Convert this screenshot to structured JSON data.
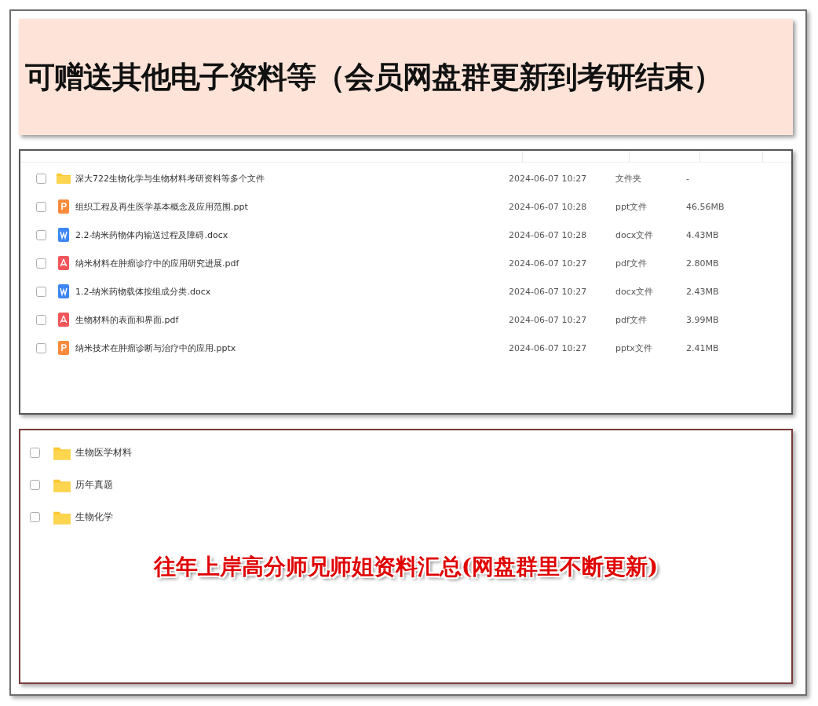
{
  "banner": {
    "title": "可赠送其他电子资料等（会员网盘群更新到考研结束）"
  },
  "file_list": {
    "rows": [
      {
        "kind": "folder",
        "name": "深大722生物化学与生物材料考研资料等多个文件",
        "modified": "2024-06-07 10:27",
        "type": "文件夹",
        "size": "-",
        "checked": false
      },
      {
        "kind": "ppt",
        "name": "组织工程及再生医学基本概念及应用范围.ppt",
        "modified": "2024-06-07 10:28",
        "type": "ppt文件",
        "size": "46.56MB",
        "checked": false
      },
      {
        "kind": "word",
        "name": "2.2-纳米药物体内输送过程及障碍.docx",
        "modified": "2024-06-07 10:28",
        "type": "docx文件",
        "size": "4.43MB",
        "checked": false
      },
      {
        "kind": "pdf",
        "name": "纳米材料在肿瘤诊疗中的应用研究进展.pdf",
        "modified": "2024-06-07 10:27",
        "type": "pdf文件",
        "size": "2.80MB",
        "checked": false
      },
      {
        "kind": "word",
        "name": "1.2-纳米药物载体按组成分类.docx",
        "modified": "2024-06-07 10:27",
        "type": "docx文件",
        "size": "2.43MB",
        "checked": false
      },
      {
        "kind": "pdf",
        "name": "生物材料的表面和界面.pdf",
        "modified": "2024-06-07 10:27",
        "type": "pdf文件",
        "size": "3.99MB",
        "checked": false
      },
      {
        "kind": "ppt",
        "name": "纳米技术在肿瘤诊断与治疗中的应用.pptx",
        "modified": "2024-06-07 10:27",
        "type": "pptx文件",
        "size": "2.41MB",
        "checked": false
      }
    ]
  },
  "folder_list": {
    "rows": [
      {
        "kind": "folder",
        "name": "生物医学材料",
        "checked": false
      },
      {
        "kind": "folder",
        "name": "历年真题",
        "checked": false
      },
      {
        "kind": "folder",
        "name": "生物化学",
        "checked": false
      }
    ],
    "caption": "往年上岸高分师兄师姐资料汇总(网盘群里不断更新)"
  }
}
